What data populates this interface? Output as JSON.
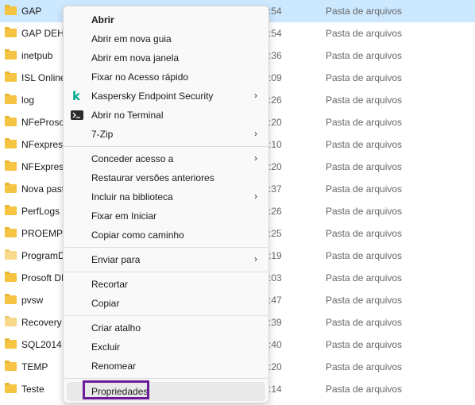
{
  "files": [
    {
      "name": "GAP",
      "date": ":54",
      "type": "Pasta de arquivos",
      "selected": true
    },
    {
      "name": "GAP DEH",
      "date": ":54",
      "type": "Pasta de arquivos"
    },
    {
      "name": "inetpub",
      "date": ":36",
      "type": "Pasta de arquivos"
    },
    {
      "name": "ISL Online",
      "date": ":09",
      "type": "Pasta de arquivos"
    },
    {
      "name": "log",
      "date": ":26",
      "type": "Pasta de arquivos"
    },
    {
      "name": "NFeProso",
      "date": ":20",
      "type": "Pasta de arquivos"
    },
    {
      "name": "NFexpress",
      "date": ":10",
      "type": "Pasta de arquivos"
    },
    {
      "name": "NFExpress",
      "date": ":20",
      "type": "Pasta de arquivos"
    },
    {
      "name": "Nova pasta",
      "date": ":37",
      "type": "Pasta de arquivos"
    },
    {
      "name": "PerfLogs",
      "date": ":26",
      "type": "Pasta de arquivos"
    },
    {
      "name": "PROEMPO",
      "date": ":25",
      "type": "Pasta de arquivos"
    },
    {
      "name": "ProgramD",
      "date": ":19",
      "type": "Pasta de arquivos",
      "faded": true
    },
    {
      "name": "Prosoft DI",
      "date": ":03",
      "type": "Pasta de arquivos"
    },
    {
      "name": "pvsw",
      "date": ":47",
      "type": "Pasta de arquivos"
    },
    {
      "name": "Recovery",
      "date": ":39",
      "type": "Pasta de arquivos",
      "faded": true
    },
    {
      "name": "SQL2014",
      "date": ":40",
      "type": "Pasta de arquivos"
    },
    {
      "name": "TEMP",
      "date": ":20",
      "type": "Pasta de arquivos"
    },
    {
      "name": "Teste",
      "date": ":14",
      "type": "Pasta de arquivos"
    }
  ],
  "menu": {
    "open": "Abrir",
    "open_new_tab": "Abrir em nova guia",
    "open_new_window": "Abrir em nova janela",
    "pin_quick_access": "Fixar no Acesso rápido",
    "kaspersky": "Kaspersky Endpoint Security",
    "open_terminal": "Abrir no Terminal",
    "seven_zip": "7-Zip",
    "grant_access": "Conceder acesso a",
    "restore_versions": "Restaurar versões anteriores",
    "include_library": "Incluir na biblioteca",
    "pin_start": "Fixar em Iniciar",
    "copy_path": "Copiar como caminho",
    "send_to": "Enviar para",
    "cut": "Recortar",
    "copy": "Copiar",
    "create_shortcut": "Criar atalho",
    "delete": "Excluir",
    "rename": "Renomear",
    "properties": "Propriedades",
    "submenu_arrow": "›"
  },
  "icons": {
    "kaspersky": "kaspersky-icon",
    "terminal": "terminal-icon",
    "folder": "folder-icon"
  },
  "colors": {
    "selection": "#cce8ff",
    "highlight_border": "#6a1b9a",
    "kaspersky_green": "#00a88e"
  }
}
